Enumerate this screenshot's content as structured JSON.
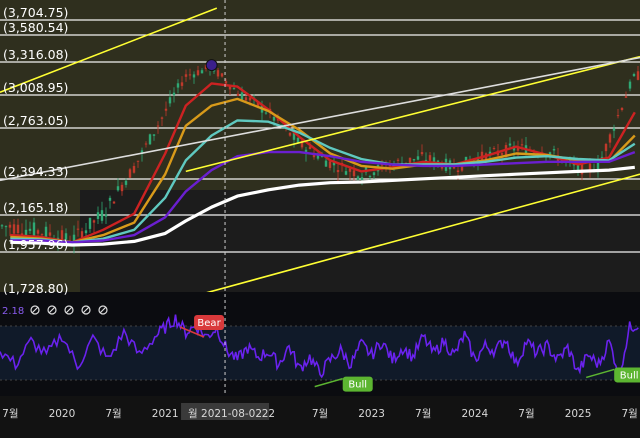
{
  "chart_data": [
    {
      "type": "line",
      "panel": "price",
      "y_axis_labels": [
        "(3,704.75)",
        "(3,580.54)",
        "(3,316.08)",
        "(3,008.95)",
        "(2,763.05)",
        "(2,394.33)",
        "(2,165.18)",
        "(1,957.96)",
        "(1,728.80)"
      ],
      "horizontal_levels": [
        3704.75,
        3580.54,
        3316.08,
        3008.95,
        2763.05,
        2394.33,
        2165.18,
        1957.96,
        1728.8
      ],
      "ylim": [
        1700,
        3760
      ],
      "xlim": [
        2019.4,
        2025.6
      ],
      "series": [
        {
          "color": "#e8e8e8",
          "style": "candles",
          "x": [
            2019.5,
            2019.8,
            2020.1,
            2020.4,
            2020.7,
            2021.0,
            2021.2,
            2021.45,
            2021.7,
            2022.0,
            2022.3,
            2022.6,
            2022.9,
            2023.2,
            2023.5,
            2023.8,
            2024.1,
            2024.4,
            2024.7,
            2025.0,
            2025.2,
            2025.4,
            2025.55
          ],
          "values": [
            2080,
            2050,
            2000,
            2150,
            2450,
            2850,
            3150,
            3230,
            3000,
            2850,
            2620,
            2480,
            2400,
            2470,
            2520,
            2450,
            2530,
            2590,
            2570,
            2440,
            2460,
            2850,
            3150
          ]
        },
        {
          "color": "#cc2222",
          "x": [
            2019.5,
            2019.8,
            2020.1,
            2020.4,
            2020.7,
            2021.0,
            2021.2,
            2021.45,
            2021.7,
            2022.0,
            2022.3,
            2022.6,
            2022.9,
            2023.2,
            2023.5,
            2023.8,
            2024.1,
            2024.4,
            2024.7,
            2025.0,
            2025.3,
            2025.55
          ],
          "values": [
            2030,
            2020,
            1990,
            2060,
            2150,
            2550,
            2900,
            3080,
            3050,
            2870,
            2670,
            2500,
            2420,
            2450,
            2490,
            2470,
            2530,
            2600,
            2540,
            2470,
            2520,
            2850
          ]
        },
        {
          "color": "#d89a1a",
          "x": [
            2019.5,
            2019.8,
            2020.1,
            2020.4,
            2020.7,
            2021.0,
            2021.2,
            2021.45,
            2021.7,
            2022.0,
            2022.3,
            2022.6,
            2022.9,
            2023.2,
            2023.5,
            2023.8,
            2024.1,
            2024.4,
            2024.7,
            2025.0,
            2025.3,
            2025.55
          ],
          "values": [
            2020,
            2010,
            1990,
            2030,
            2100,
            2400,
            2750,
            2900,
            2950,
            2860,
            2720,
            2550,
            2460,
            2440,
            2470,
            2470,
            2500,
            2550,
            2540,
            2500,
            2490,
            2680
          ]
        },
        {
          "color": "#5fc9c0",
          "x": [
            2019.5,
            2019.8,
            2020.1,
            2020.4,
            2020.7,
            2021.0,
            2021.2,
            2021.45,
            2021.7,
            2022.0,
            2022.3,
            2022.6,
            2022.9,
            2023.2,
            2023.5,
            2023.8,
            2024.1,
            2024.4,
            2024.7,
            2025.0,
            2025.3,
            2025.55
          ],
          "values": [
            2010,
            2005,
            1990,
            2010,
            2060,
            2250,
            2500,
            2680,
            2790,
            2780,
            2700,
            2590,
            2510,
            2470,
            2470,
            2470,
            2490,
            2520,
            2530,
            2510,
            2500,
            2620
          ]
        },
        {
          "color": "#6a1fd0",
          "x": [
            2019.5,
            2019.8,
            2020.1,
            2020.4,
            2020.7,
            2021.0,
            2021.2,
            2021.45,
            2021.7,
            2022.0,
            2022.3,
            2022.6,
            2022.9,
            2023.2,
            2023.5,
            2023.8,
            2024.1,
            2024.4,
            2024.7,
            2025.0,
            2025.3,
            2025.55
          ],
          "values": [
            2000,
            2000,
            1990,
            2000,
            2030,
            2130,
            2290,
            2430,
            2530,
            2560,
            2560,
            2530,
            2490,
            2470,
            2460,
            2460,
            2470,
            2480,
            2490,
            2490,
            2490,
            2560
          ]
        },
        {
          "color": "#ffffff",
          "x": [
            2019.5,
            2019.8,
            2020.1,
            2020.4,
            2020.7,
            2021.0,
            2021.2,
            2021.45,
            2021.7,
            2022.0,
            2022.3,
            2022.6,
            2022.9,
            2023.2,
            2023.5,
            2023.8,
            2024.1,
            2024.4,
            2024.7,
            2025.0,
            2025.3,
            2025.55
          ],
          "values": [
            1990,
            1985,
            1975,
            1980,
            1995,
            2040,
            2110,
            2190,
            2260,
            2300,
            2330,
            2345,
            2350,
            2360,
            2370,
            2380,
            2390,
            2400,
            2410,
            2420,
            2430,
            2450
          ]
        },
        {
          "color": "#ffff33",
          "x": [
            2019.4,
            2021.5
          ],
          "values": [
            3000,
            3770
          ]
        },
        {
          "color": "#ffff33",
          "x": [
            2021.2,
            2025.6
          ],
          "values": [
            2420,
            3330
          ]
        },
        {
          "color": "#ffff33",
          "x": [
            2021.3,
            2025.6
          ],
          "values": [
            1710,
            2400
          ]
        },
        {
          "color": "#dddddd",
          "x": [
            2019.4,
            2025.6
          ],
          "values": [
            2360,
            3320
          ]
        }
      ],
      "markers": [
        {
          "x": 2021.45,
          "y": 3250,
          "color": "#3b1f8c"
        }
      ],
      "crosshair": {
        "y_label": "",
        "x": 2021.58
      }
    },
    {
      "type": "line",
      "panel": "RSI",
      "value_label": "2.18",
      "ylim": [
        0,
        100
      ],
      "bands": [
        30,
        70
      ],
      "series": [
        {
          "color": "#6a22ee",
          "x": [
            2019.4,
            2019.55,
            2019.7,
            2019.85,
            2020.0,
            2020.15,
            2020.3,
            2020.45,
            2020.6,
            2020.75,
            2020.9,
            2021.0,
            2021.1,
            2021.2,
            2021.3,
            2021.4,
            2021.5,
            2021.6,
            2021.7,
            2021.8,
            2021.9,
            2022.0,
            2022.1,
            2022.2,
            2022.3,
            2022.4,
            2022.5,
            2022.6,
            2022.7,
            2022.8,
            2022.9,
            2023.0,
            2023.1,
            2023.2,
            2023.3,
            2023.4,
            2023.5,
            2023.6,
            2023.7,
            2023.8,
            2023.9,
            2024.0,
            2024.1,
            2024.2,
            2024.3,
            2024.4,
            2024.5,
            2024.6,
            2024.7,
            2024.8,
            2024.9,
            2025.0,
            2025.1,
            2025.2,
            2025.3,
            2025.4,
            2025.5,
            2025.6
          ],
          "values": [
            45,
            30,
            55,
            40,
            62,
            28,
            58,
            35,
            65,
            40,
            60,
            70,
            80,
            65,
            72,
            60,
            70,
            45,
            35,
            48,
            38,
            44,
            30,
            50,
            25,
            38,
            20,
            35,
            45,
            30,
            52,
            40,
            55,
            35,
            48,
            38,
            60,
            42,
            55,
            40,
            62,
            35,
            50,
            45,
            58,
            30,
            55,
            42,
            50,
            35,
            48,
            22,
            40,
            30,
            55,
            20,
            70,
            75
          ]
        }
      ],
      "annotations": [
        {
          "label": "Bear",
          "x": 2021.28,
          "y": 75,
          "color": "#d9393b"
        },
        {
          "label": "Bull",
          "x": 2022.72,
          "y": 8,
          "color": "#5cb531"
        },
        {
          "label": "Bull",
          "x": 2025.35,
          "y": 18,
          "color": "#5cb531"
        }
      ]
    }
  ],
  "x_axis": {
    "labels": [
      "7월",
      "2020",
      "7월",
      "2021",
      "월 2021-08-02",
      "22",
      "7월",
      "2023",
      "7월",
      "2024",
      "7월",
      "2025",
      "7월"
    ],
    "positions": [
      2019.5,
      2020.0,
      2020.5,
      2021.0,
      2021.58,
      2022.0,
      2022.5,
      2023.0,
      2023.5,
      2024.0,
      2024.5,
      2025.0,
      2025.5
    ]
  },
  "toolbar": {
    "icons": [
      "hidden-icon",
      "hidden-icon",
      "hidden-icon",
      "hidden-icon",
      "hidden-icon"
    ]
  },
  "colors": {
    "plot_bg": "#2f2f1f",
    "gold_band": "#3a3a24",
    "rsi_bg": "#0d1622",
    "axis_bg": "#121212"
  }
}
